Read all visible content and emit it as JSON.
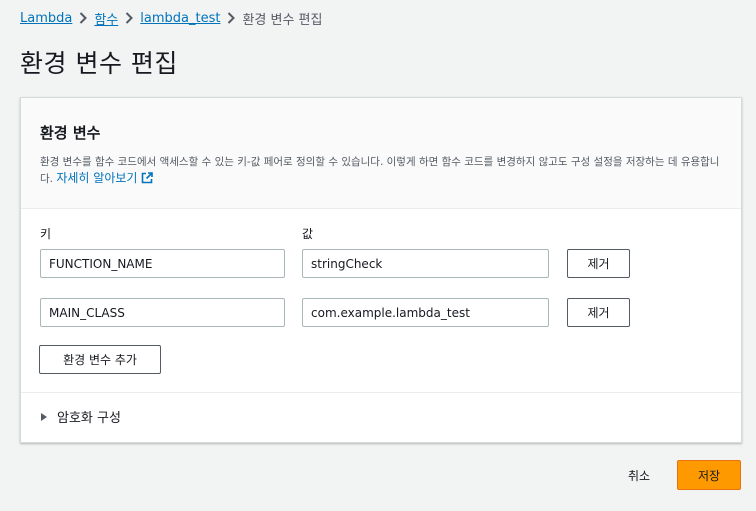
{
  "breadcrumb": {
    "items": [
      {
        "label": "Lambda"
      },
      {
        "label": "함수"
      },
      {
        "label": "lambda_test"
      }
    ],
    "current": "환경 변수 편집"
  },
  "page_title": "환경 변수 편집",
  "panel": {
    "title": "환경 변수",
    "description": "환경 변수를 함수 코드에서 액세스할 수 있는 키-값 페어로 정의할 수 있습니다. 이렇게 하면 함수 코드를 변경하지 않고도 구성 설정을 저장하는 데 유용합니다.",
    "learn_more": "자세히 알아보기",
    "key_label": "키",
    "value_label": "값",
    "variables": [
      {
        "key": "FUNCTION_NAME",
        "value": "stringCheck",
        "remove_label": "제거"
      },
      {
        "key": "MAIN_CLASS",
        "value": "com.example.lambda_test",
        "remove_label": "제거"
      }
    ],
    "add_label": "환경 변수 추가",
    "encryption_label": "암호화 구성"
  },
  "footer": {
    "cancel_label": "취소",
    "save_label": "저장"
  },
  "colors": {
    "link": "#0073bb",
    "primary": "#ff9900",
    "background": "#f2f3f3"
  }
}
